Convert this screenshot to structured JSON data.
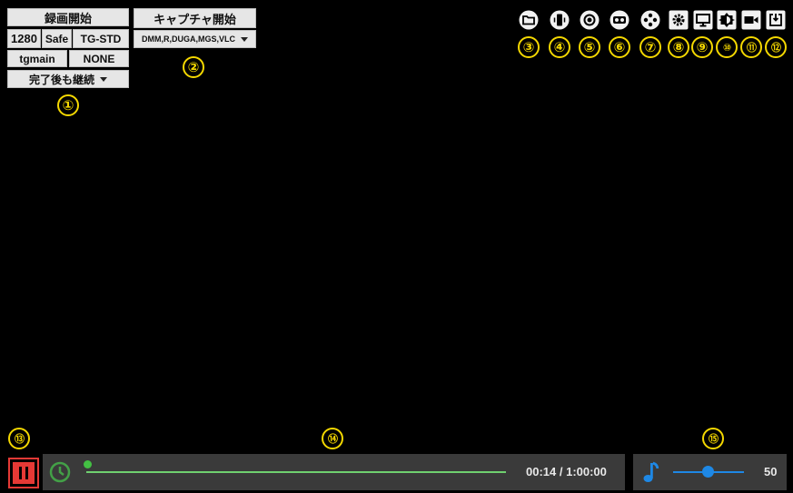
{
  "record": {
    "start_label": "録画開始"
  },
  "capture": {
    "start_label": "キャプチャ開始",
    "sources_value": "DMM,R,DUGA,MGS,VLC"
  },
  "settings": {
    "resolution": "1280",
    "mode": "Safe",
    "format": "TG-STD",
    "profile": "tgmain",
    "option": "NONE",
    "after_complete": "完了後も継続"
  },
  "markers": [
    "①",
    "②",
    "③",
    "④",
    "⑤",
    "⑥",
    "⑦",
    "⑧",
    "⑨",
    "⑩",
    "⑪",
    "⑫",
    "⑬",
    "⑭",
    "⑮"
  ],
  "toolbar_icons": [
    "folder-icon",
    "phone-rotate-icon",
    "record-target-icon",
    "vr-glasses-icon",
    "gamepad-icon",
    "gear-icon",
    "monitor-icon",
    "brightness-icon",
    "video-camera-icon",
    "exit-icon"
  ],
  "playback": {
    "time_display": "00:14 / 1:00:00",
    "progress": 0.0039
  },
  "volume": {
    "value_label": "50",
    "level": 0.5
  },
  "colors": {
    "marker": "#f5d800",
    "pause": "#e53935",
    "clock": "#43a047",
    "seek": "#6fd06f",
    "volume": "#1e88e5"
  }
}
